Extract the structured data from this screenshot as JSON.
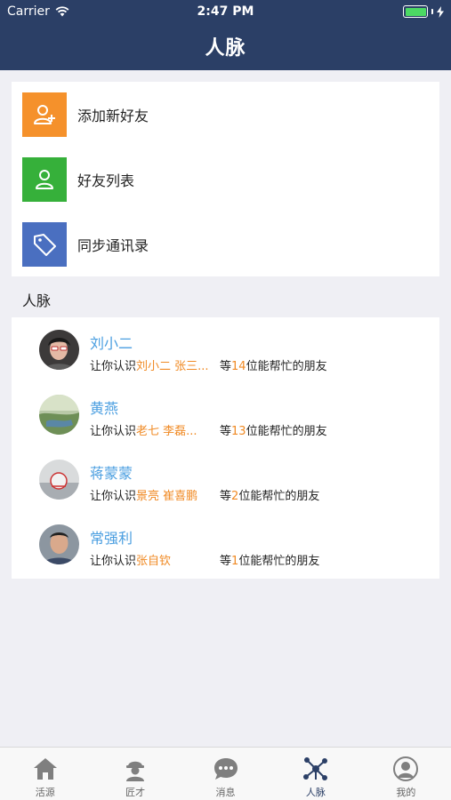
{
  "status_bar": {
    "carrier": "Carrier",
    "time": "2:47 PM"
  },
  "nav": {
    "title": "人脉"
  },
  "menu": {
    "items": [
      {
        "label": "添加新好友",
        "icon": "add-user-icon",
        "color": "#f5912b"
      },
      {
        "label": "好友列表",
        "icon": "user-icon",
        "color": "#36b03a"
      },
      {
        "label": "同步通讯录",
        "icon": "tag-icon",
        "color": "#4a6fc0"
      }
    ]
  },
  "section": {
    "title": "人脉"
  },
  "contacts": [
    {
      "name": "刘小二",
      "prefix": "让你认识",
      "friends": "刘小二 张三...",
      "mid": "等",
      "count": "14",
      "suffix": "位能帮忙的朋友"
    },
    {
      "name": "黄燕",
      "prefix": "让你认识",
      "friends": "老七 李磊...",
      "mid": "等",
      "count": "13",
      "suffix": "位能帮忙的朋友"
    },
    {
      "name": "蒋蒙蒙",
      "prefix": "让你认识",
      "friends": "景亮 崔喜鹏",
      "mid": "等",
      "count": "2",
      "suffix": "位能帮忙的朋友"
    },
    {
      "name": "常强利",
      "prefix": "让你认识",
      "friends": "张自钦",
      "mid": "等",
      "count": "1",
      "suffix": "位能帮忙的朋友"
    }
  ],
  "tabbar": {
    "items": [
      {
        "label": "活源",
        "icon": "home-icon"
      },
      {
        "label": "匠才",
        "icon": "worker-icon"
      },
      {
        "label": "消息",
        "icon": "chat-icon"
      },
      {
        "label": "人脉",
        "icon": "network-icon",
        "active": true
      },
      {
        "label": "我的",
        "icon": "profile-icon"
      }
    ]
  },
  "colors": {
    "header": "#2b3f66",
    "accent_orange": "#f08a24",
    "name_blue": "#4a9ee0"
  }
}
